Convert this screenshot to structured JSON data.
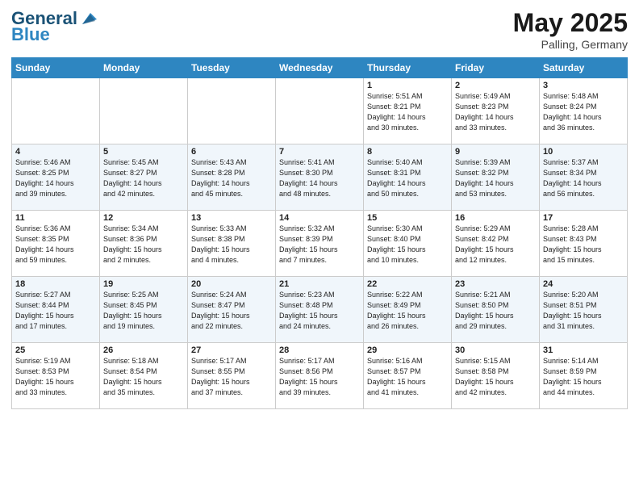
{
  "header": {
    "logo_text1": "General",
    "logo_text2": "Blue",
    "month": "May 2025",
    "location": "Palling, Germany"
  },
  "weekdays": [
    "Sunday",
    "Monday",
    "Tuesday",
    "Wednesday",
    "Thursday",
    "Friday",
    "Saturday"
  ],
  "weeks": [
    [
      {
        "day": "",
        "info": ""
      },
      {
        "day": "",
        "info": ""
      },
      {
        "day": "",
        "info": ""
      },
      {
        "day": "",
        "info": ""
      },
      {
        "day": "1",
        "info": "Sunrise: 5:51 AM\nSunset: 8:21 PM\nDaylight: 14 hours\nand 30 minutes."
      },
      {
        "day": "2",
        "info": "Sunrise: 5:49 AM\nSunset: 8:23 PM\nDaylight: 14 hours\nand 33 minutes."
      },
      {
        "day": "3",
        "info": "Sunrise: 5:48 AM\nSunset: 8:24 PM\nDaylight: 14 hours\nand 36 minutes."
      }
    ],
    [
      {
        "day": "4",
        "info": "Sunrise: 5:46 AM\nSunset: 8:25 PM\nDaylight: 14 hours\nand 39 minutes."
      },
      {
        "day": "5",
        "info": "Sunrise: 5:45 AM\nSunset: 8:27 PM\nDaylight: 14 hours\nand 42 minutes."
      },
      {
        "day": "6",
        "info": "Sunrise: 5:43 AM\nSunset: 8:28 PM\nDaylight: 14 hours\nand 45 minutes."
      },
      {
        "day": "7",
        "info": "Sunrise: 5:41 AM\nSunset: 8:30 PM\nDaylight: 14 hours\nand 48 minutes."
      },
      {
        "day": "8",
        "info": "Sunrise: 5:40 AM\nSunset: 8:31 PM\nDaylight: 14 hours\nand 50 minutes."
      },
      {
        "day": "9",
        "info": "Sunrise: 5:39 AM\nSunset: 8:32 PM\nDaylight: 14 hours\nand 53 minutes."
      },
      {
        "day": "10",
        "info": "Sunrise: 5:37 AM\nSunset: 8:34 PM\nDaylight: 14 hours\nand 56 minutes."
      }
    ],
    [
      {
        "day": "11",
        "info": "Sunrise: 5:36 AM\nSunset: 8:35 PM\nDaylight: 14 hours\nand 59 minutes."
      },
      {
        "day": "12",
        "info": "Sunrise: 5:34 AM\nSunset: 8:36 PM\nDaylight: 15 hours\nand 2 minutes."
      },
      {
        "day": "13",
        "info": "Sunrise: 5:33 AM\nSunset: 8:38 PM\nDaylight: 15 hours\nand 4 minutes."
      },
      {
        "day": "14",
        "info": "Sunrise: 5:32 AM\nSunset: 8:39 PM\nDaylight: 15 hours\nand 7 minutes."
      },
      {
        "day": "15",
        "info": "Sunrise: 5:30 AM\nSunset: 8:40 PM\nDaylight: 15 hours\nand 10 minutes."
      },
      {
        "day": "16",
        "info": "Sunrise: 5:29 AM\nSunset: 8:42 PM\nDaylight: 15 hours\nand 12 minutes."
      },
      {
        "day": "17",
        "info": "Sunrise: 5:28 AM\nSunset: 8:43 PM\nDaylight: 15 hours\nand 15 minutes."
      }
    ],
    [
      {
        "day": "18",
        "info": "Sunrise: 5:27 AM\nSunset: 8:44 PM\nDaylight: 15 hours\nand 17 minutes."
      },
      {
        "day": "19",
        "info": "Sunrise: 5:25 AM\nSunset: 8:45 PM\nDaylight: 15 hours\nand 19 minutes."
      },
      {
        "day": "20",
        "info": "Sunrise: 5:24 AM\nSunset: 8:47 PM\nDaylight: 15 hours\nand 22 minutes."
      },
      {
        "day": "21",
        "info": "Sunrise: 5:23 AM\nSunset: 8:48 PM\nDaylight: 15 hours\nand 24 minutes."
      },
      {
        "day": "22",
        "info": "Sunrise: 5:22 AM\nSunset: 8:49 PM\nDaylight: 15 hours\nand 26 minutes."
      },
      {
        "day": "23",
        "info": "Sunrise: 5:21 AM\nSunset: 8:50 PM\nDaylight: 15 hours\nand 29 minutes."
      },
      {
        "day": "24",
        "info": "Sunrise: 5:20 AM\nSunset: 8:51 PM\nDaylight: 15 hours\nand 31 minutes."
      }
    ],
    [
      {
        "day": "25",
        "info": "Sunrise: 5:19 AM\nSunset: 8:53 PM\nDaylight: 15 hours\nand 33 minutes."
      },
      {
        "day": "26",
        "info": "Sunrise: 5:18 AM\nSunset: 8:54 PM\nDaylight: 15 hours\nand 35 minutes."
      },
      {
        "day": "27",
        "info": "Sunrise: 5:17 AM\nSunset: 8:55 PM\nDaylight: 15 hours\nand 37 minutes."
      },
      {
        "day": "28",
        "info": "Sunrise: 5:17 AM\nSunset: 8:56 PM\nDaylight: 15 hours\nand 39 minutes."
      },
      {
        "day": "29",
        "info": "Sunrise: 5:16 AM\nSunset: 8:57 PM\nDaylight: 15 hours\nand 41 minutes."
      },
      {
        "day": "30",
        "info": "Sunrise: 5:15 AM\nSunset: 8:58 PM\nDaylight: 15 hours\nand 42 minutes."
      },
      {
        "day": "31",
        "info": "Sunrise: 5:14 AM\nSunset: 8:59 PM\nDaylight: 15 hours\nand 44 minutes."
      }
    ]
  ]
}
